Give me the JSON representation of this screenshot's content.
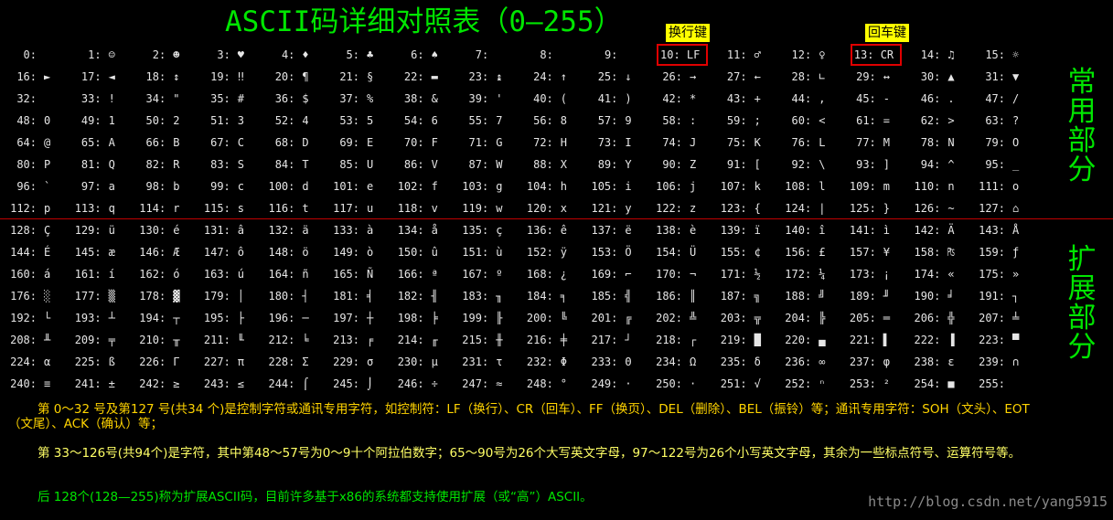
{
  "title": "ASCII码详细对照表（0—255）",
  "tags": {
    "newline_tag": "换行键",
    "cr_tag": "回车键"
  },
  "side_labels": {
    "common": [
      "常",
      "用",
      "部",
      "分"
    ],
    "extended": [
      "扩",
      "展",
      "部",
      "分"
    ]
  },
  "highlighted_codes": [
    10,
    13
  ],
  "rows": [
    [
      "0:",
      "1:☺",
      "2:☻",
      "3:♥",
      "4:♦",
      "5:♣",
      "6:♠",
      "7:",
      "8:",
      "9:",
      "10: LF",
      "11:♂",
      "12:♀",
      "13: CR",
      "14:♫",
      "15:☼"
    ],
    [
      "16:►",
      "17:◄",
      "18:↕",
      "19:‼",
      "20:¶",
      "21:§",
      "22:▬",
      "23:↨",
      "24:↑",
      "25:↓",
      "26:→",
      "27:←",
      "28:∟",
      "29:↔",
      "30:▲",
      "31:▼"
    ],
    [
      "32:",
      "33:!",
      "34:\"",
      "35:#",
      "36:$",
      "37:%",
      "38:&",
      "39:'",
      "40:(",
      "41:)",
      "42:*",
      "43:+",
      "44:,",
      "45:-",
      "46:.",
      "47:/"
    ],
    [
      "48:0",
      "49:1",
      "50:2",
      "51:3",
      "52:4",
      "53:5",
      "54:6",
      "55:7",
      "56:8",
      "57:9",
      "58::",
      "59:;",
      "60:<",
      "61:=",
      "62:>",
      "63:?"
    ],
    [
      "64:@",
      "65:A",
      "66:B",
      "67:C",
      "68:D",
      "69:E",
      "70:F",
      "71:G",
      "72:H",
      "73:I",
      "74:J",
      "75:K",
      "76:L",
      "77:M",
      "78:N",
      "79:O"
    ],
    [
      "80:P",
      "81:Q",
      "82:R",
      "83:S",
      "84:T",
      "85:U",
      "86:V",
      "87:W",
      "88:X",
      "89:Y",
      "90:Z",
      "91:[",
      "92:\\",
      "93:]",
      "94:^",
      "95:_"
    ],
    [
      "96:`",
      "97:a",
      "98:b",
      "99:c",
      "100:d",
      "101:e",
      "102:f",
      "103:g",
      "104:h",
      "105:i",
      "106:j",
      "107:k",
      "108:l",
      "109:m",
      "110:n",
      "111:o"
    ],
    [
      "112:p",
      "113:q",
      "114:r",
      "115:s",
      "116:t",
      "117:u",
      "118:v",
      "119:w",
      "120:x",
      "121:y",
      "122:z",
      "123:{",
      "124:|",
      "125:}",
      "126:~",
      "127:⌂"
    ],
    [
      "128:Ç",
      "129:ü",
      "130:é",
      "131:â",
      "132:ä",
      "133:à",
      "134:å",
      "135:ç",
      "136:ê",
      "137:ë",
      "138:è",
      "139:ï",
      "140:î",
      "141:ì",
      "142:Ä",
      "143:Å"
    ],
    [
      "144:É",
      "145:æ",
      "146:Æ",
      "147:ô",
      "148:ö",
      "149:ò",
      "150:û",
      "151:ù",
      "152:ÿ",
      "153:Ö",
      "154:Ü",
      "155:¢",
      "156:£",
      "157:¥",
      "158:₧",
      "159:ƒ"
    ],
    [
      "160:á",
      "161:í",
      "162:ó",
      "163:ú",
      "164:ñ",
      "165:Ñ",
      "166:ª",
      "167:º",
      "168:¿",
      "169:⌐",
      "170:¬",
      "171:½",
      "172:¼",
      "173:¡",
      "174:«",
      "175:»"
    ],
    [
      "176:░",
      "177:▒",
      "178:▓",
      "179:│",
      "180:┤",
      "181:╡",
      "182:╢",
      "183:╖",
      "184:╕",
      "185:╣",
      "186:║",
      "187:╗",
      "188:╝",
      "189:╜",
      "190:╛",
      "191:┐"
    ],
    [
      "192:└",
      "193:┴",
      "194:┬",
      "195:├",
      "196:─",
      "197:┼",
      "198:╞",
      "199:╟",
      "200:╚",
      "201:╔",
      "202:╩",
      "203:╦",
      "204:╠",
      "205:═",
      "206:╬",
      "207:╧"
    ],
    [
      "208:╨",
      "209:╤",
      "210:╥",
      "211:╙",
      "212:╘",
      "213:╒",
      "214:╓",
      "215:╫",
      "216:╪",
      "217:┘",
      "218:┌",
      "219:█",
      "220:▄",
      "221:▌",
      "222:▐",
      "223:▀"
    ],
    [
      "224:α",
      "225:ß",
      "226:Γ",
      "227:π",
      "228:Σ",
      "229:σ",
      "230:µ",
      "231:τ",
      "232:Φ",
      "233:Θ",
      "234:Ω",
      "235:δ",
      "236:∞",
      "237:φ",
      "238:ε",
      "239:∩"
    ],
    [
      "240:≡",
      "241:±",
      "242:≥",
      "243:≤",
      "244:⌠",
      "245:⌡",
      "246:÷",
      "247:≈",
      "248:°",
      "249:·",
      "250:·",
      "251:√",
      "252:ⁿ",
      "253:²",
      "254:■",
      "255: "
    ]
  ],
  "notes": [
    "第 0～32 号及第127 号(共34 个)是控制字符或通讯专用字符，如控制符：LF（换行）、CR（回车）、FF（换页）、DEL（删除）、BEL（振铃）等；通讯专用字符：SOH（文头）、EOT（文尾）、ACK（确认）等；",
    "第 33～126号(共94个)是字符，其中第48～57号为0～9十个阿拉伯数字；65～90号为26个大写英文字母，97～122号为26个小写英文字母，其余为一些标点符号、运算符号等。",
    "后 128个(128—255)称为扩展ASCII码，目前许多基于x86的系统都支持使用扩展（或“高”）ASCII。"
  ],
  "watermark": "http://blog.csdn.net/yang5915",
  "colors": {
    "title": "#00e600",
    "divider": "#c00000",
    "highlight_box": "#e00000",
    "tag_bg": "#ffff00"
  }
}
